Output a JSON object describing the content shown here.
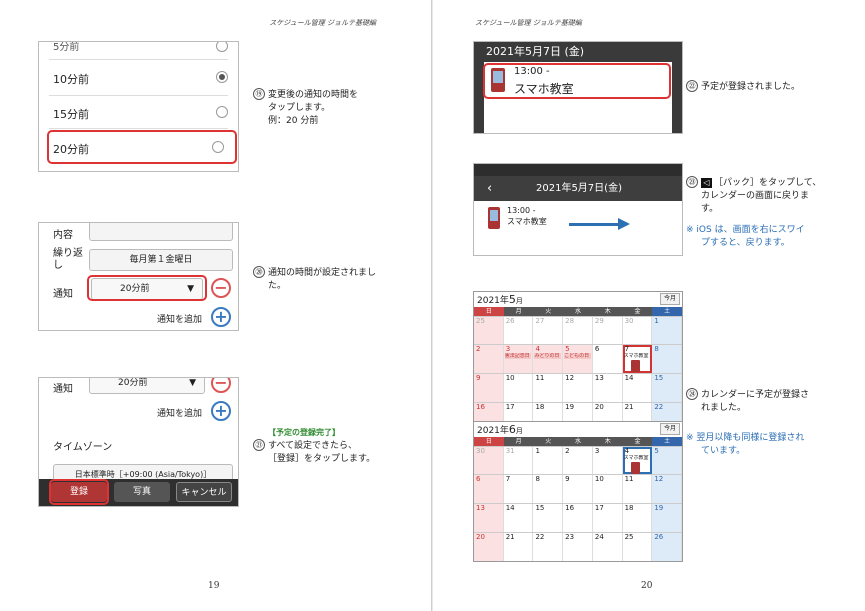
{
  "header_text": "スケジュール管理 ジョルテ基礎編",
  "left": {
    "page_number": "19",
    "shot1": {
      "partial_top": "5分前",
      "options": [
        "10分前",
        "15分前",
        "20分前"
      ],
      "selected_index": 0
    },
    "step19": {
      "num": "⑲",
      "lines": [
        "変更後の通知の時間を",
        "タップします。",
        "例：20 分前"
      ]
    },
    "shot2": {
      "content_label": "内容",
      "repeat_label": "繰り返し",
      "repeat_value": "毎月第１金曜日",
      "notify_label": "通知",
      "notify_value": "20分前",
      "add_notify": "通知を追加"
    },
    "step20": {
      "num": "⑳",
      "lines": [
        "通知の時間が設定されまし",
        "た。"
      ]
    },
    "shot3": {
      "notify_label": "通知",
      "notify_value": "20分前",
      "add_notify": "通知を追加",
      "timezone_label": "タイムゾーン",
      "timezone_value": "日本標準時［+09:00 (Asia/Tokyo)］",
      "register": "登録",
      "photo": "写真",
      "cancel": "キャンセル"
    },
    "step21": {
      "heading": "【予定の登録完了】",
      "num": "㉑",
      "lines": [
        "すべて設定できたら、",
        "［登録］をタップします。"
      ]
    }
  },
  "right": {
    "page_number": "20",
    "shot4": {
      "date": "2021年5月7日 (金)",
      "time": "13:00 -",
      "title": "スマホ教室"
    },
    "step22": {
      "num": "㉒",
      "lines": [
        "予定が登録されました。"
      ]
    },
    "shot5": {
      "date": "2021年5月7日(金)",
      "time": "13:00 -",
      "title": "スマホ教室"
    },
    "step23": {
      "num": "㉓",
      "lines": [
        "［パック］をタップして、",
        "カレンダーの画面に戻りま",
        "す。"
      ]
    },
    "note23": {
      "mark": "※",
      "lines": [
        "iOS は、画面を右にスワイ",
        "プすると、戻ります。"
      ]
    },
    "calendar_may": {
      "year": "2021年",
      "month": "5",
      "month_suffix": "月",
      "today": "今月",
      "dow": [
        "日",
        "月",
        "火",
        "水",
        "木",
        "金",
        "土"
      ],
      "weeks": [
        [
          "25",
          "26",
          "27",
          "28",
          "29",
          "30",
          "1"
        ],
        [
          "2",
          "3",
          "4",
          "5",
          "6",
          "7",
          "8"
        ],
        [
          "9",
          "10",
          "11",
          "12",
          "13",
          "14",
          "15"
        ],
        [
          "16",
          "17",
          "18",
          "19",
          "20",
          "21",
          "22"
        ]
      ],
      "events": {
        "29": "昭和の日",
        "3": "憲法記念日",
        "4": "みどりの日",
        "5": "こどもの日",
        "7": "スマホ教室"
      }
    },
    "calendar_jun": {
      "year": "2021年",
      "month": "6",
      "month_suffix": "月",
      "today": "今月",
      "dow": [
        "日",
        "月",
        "火",
        "水",
        "木",
        "金",
        "土"
      ],
      "weeks": [
        [
          "30",
          "31",
          "1",
          "2",
          "3",
          "4",
          "5"
        ],
        [
          "6",
          "7",
          "8",
          "9",
          "10",
          "11",
          "12"
        ],
        [
          "13",
          "14",
          "15",
          "16",
          "17",
          "18",
          "19"
        ],
        [
          "20",
          "21",
          "22",
          "23",
          "24",
          "25",
          "26"
        ]
      ],
      "events": {
        "4": "スマホ教室"
      }
    },
    "step24": {
      "num": "㉔",
      "lines": [
        "カレンダーに予定が登録さ",
        "れました。"
      ]
    },
    "note24": {
      "mark": "※",
      "lines": [
        "翌月以降も同様に登録され",
        "ています。"
      ]
    },
    "colors": {
      "red_frame": "#d33333",
      "note_blue": "#2a6db5",
      "heading_green": "#2e8b2e",
      "arrow_blue": "#2d6fb3"
    }
  }
}
